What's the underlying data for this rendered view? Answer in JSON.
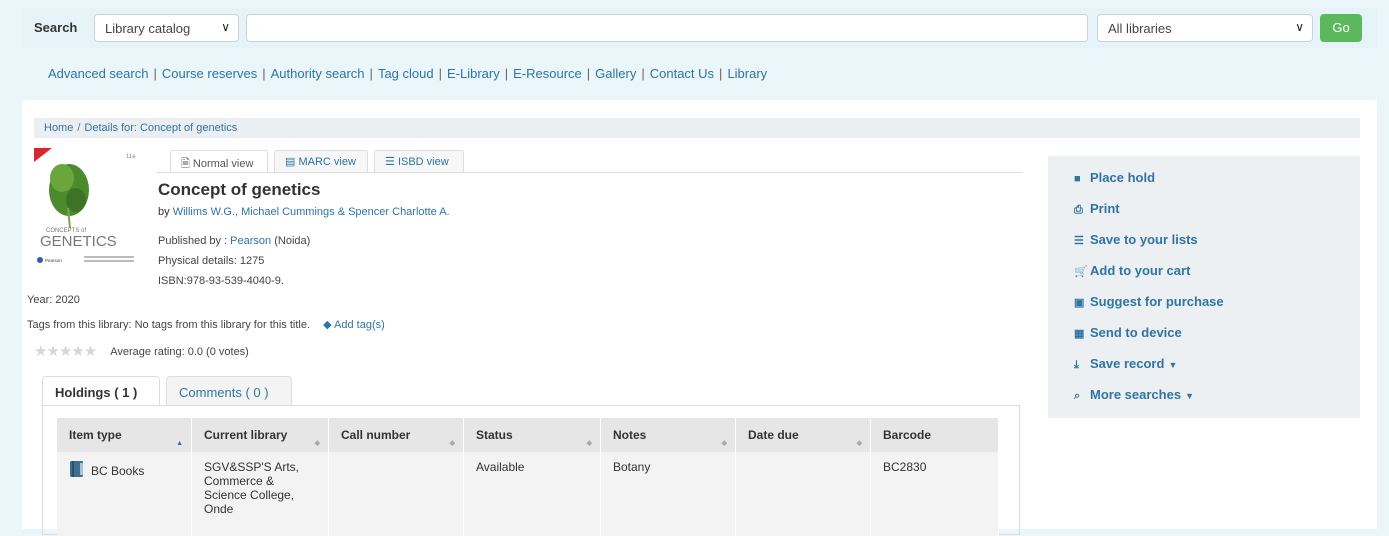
{
  "search": {
    "label": "Search",
    "catalog_select": "Library catalog",
    "query_value": "",
    "library_select": "All libraries",
    "go_label": "Go"
  },
  "nav_links": [
    "Advanced search",
    "Course reserves",
    "Authority search",
    "Tag cloud",
    "E-Library",
    "E-Resource",
    "Gallery",
    "Contact Us",
    "Library"
  ],
  "breadcrumb": {
    "home": "Home",
    "current": "Details for: Concept of genetics"
  },
  "cover": {
    "edition": "11e",
    "text_small": "CONCEPTS of",
    "text_big": "GENETICS",
    "publisher": "Pearson"
  },
  "view_tabs": [
    "Normal view",
    "MARC view",
    "ISBD view"
  ],
  "record": {
    "title": "Concept of genetics",
    "by_label": "by",
    "authors": "Willims W.G., Michael Cummings & Spencer Charlotte A.",
    "published_label": "Published by :",
    "publisher": "Pearson",
    "place": "(Noida)",
    "physical": "Physical details: 1275",
    "isbn": "ISBN:978-93-539-4040-9.",
    "year": "Year: 2020",
    "tags_label": "Tags from this library:",
    "tags_value": "No tags from this library for this title.",
    "add_tag": "Add tag(s)",
    "rating": "Average rating: 0.0 (0 votes)"
  },
  "holdings_tabs": [
    "Holdings ( 1 )",
    "Comments ( 0 )"
  ],
  "holdings_table": {
    "headers": [
      "Item type",
      "Current library",
      "Call number",
      "Status",
      "Notes",
      "Date due",
      "Barcode"
    ],
    "rows": [
      [
        "BC Books",
        "SGV&SSP'S Arts, Commerce & Science College, Onde",
        "",
        "Available",
        "Botany",
        "",
        "BC2830"
      ]
    ]
  },
  "actions": [
    "Place hold",
    "Print",
    "Save to your lists",
    "Add to your cart",
    "Suggest for purchase",
    "Send to device",
    "Save record",
    "More searches"
  ],
  "colors": {
    "link": "#2f74a3",
    "go_button": "#5cb85c",
    "available": "#3f8f3f"
  }
}
